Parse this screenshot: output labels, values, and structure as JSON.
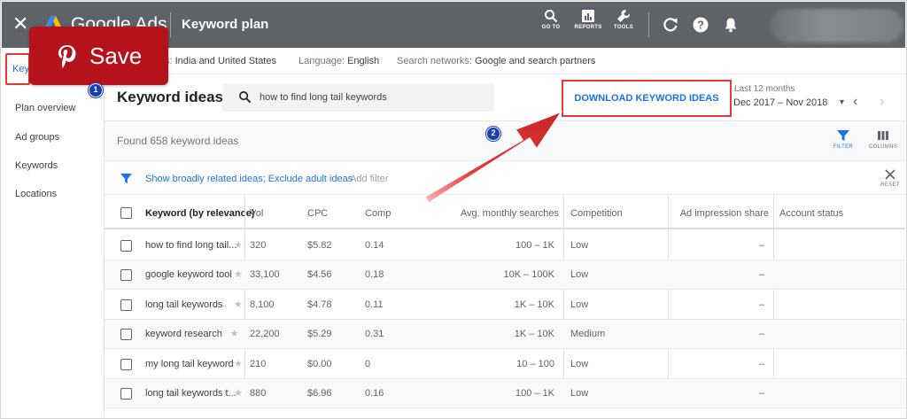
{
  "header": {
    "brand": "Google Ads",
    "page_title": "Keyword plan",
    "tools": [
      {
        "label": "GO TO"
      },
      {
        "label": "REPORTS"
      },
      {
        "label": "TOOLS"
      }
    ]
  },
  "overlay": {
    "save_label": "Save"
  },
  "sidebar": {
    "active_label": "Key",
    "items": [
      {
        "label": "Plan overview"
      },
      {
        "label": "Ad groups"
      },
      {
        "label": "Keywords"
      },
      {
        "label": "Locations"
      }
    ]
  },
  "infobar": {
    "locations_label": "s:",
    "locations_value": "India and United States",
    "language_label": "Language:",
    "language_value": "English",
    "networks_label": "Search networks:",
    "networks_value": "Google and search partners"
  },
  "ideas": {
    "title": "Keyword ideas",
    "search_value": "how to find long tail keywords",
    "download_label": "DOWNLOAD KEYWORD IDEAS",
    "date_label": "Last 12 months",
    "date_value": "Dec 2017 – Nov 2018",
    "found_text": "Found 658 keyword ideas",
    "filter_label": "FILTER",
    "columns_label": "COLUMNS",
    "reset_label": "RESET",
    "filter_links": "Show broadly related ideas; Exclude adult ideas",
    "add_filter": "Add filter"
  },
  "badges": {
    "step1": "1",
    "step2": "2"
  },
  "table": {
    "headers": {
      "keyword": "Keyword (by relevance)",
      "vol": "Vol",
      "cpc": "CPC",
      "comp": "Comp",
      "avg": "Avg. monthly searches",
      "competition": "Competition",
      "impression": "Ad impression share",
      "status": "Account status"
    },
    "rows": [
      {
        "keyword": "how to find long tail...",
        "vol": "320",
        "cpc": "$5.82",
        "comp": "0.14",
        "avg": "100 – 1K",
        "competition": "Low",
        "impression": "–"
      },
      {
        "keyword": "google keyword tool",
        "vol": "33,100",
        "cpc": "$4.56",
        "comp": "0.18",
        "avg": "10K – 100K",
        "competition": "Low",
        "impression": "–"
      },
      {
        "keyword": "long tail keywords",
        "vol": "8,100",
        "cpc": "$4.78",
        "comp": "0.11",
        "avg": "1K – 10K",
        "competition": "Low",
        "impression": "–"
      },
      {
        "keyword": "keyword research",
        "vol": "22,200",
        "cpc": "$5.29",
        "comp": "0.31",
        "avg": "1K – 10K",
        "competition": "Medium",
        "impression": "–"
      },
      {
        "keyword": "my long tail keyword",
        "vol": "210",
        "cpc": "$0.00",
        "comp": "0",
        "avg": "10 – 100",
        "competition": "Low",
        "impression": "–"
      },
      {
        "keyword": "long tail keywords t...",
        "vol": "880",
        "cpc": "$6.96",
        "comp": "0.16",
        "avg": "100 – 1K",
        "competition": "Low",
        "impression": "–"
      }
    ]
  },
  "colors": {
    "header_bg": "#5f6368",
    "accent": "#1a73e8",
    "highlight": "#e53935",
    "pinterest": "#b5121b"
  }
}
